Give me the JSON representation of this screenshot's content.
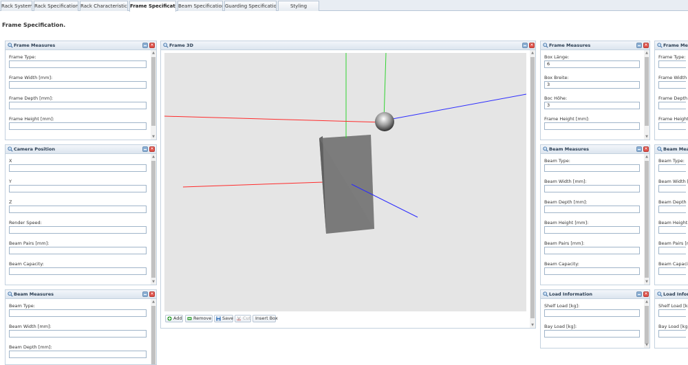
{
  "tabs": [
    {
      "label": "Rack System",
      "active": false
    },
    {
      "label": "Rack Specification",
      "active": false
    },
    {
      "label": "Rack Characteristics",
      "active": false
    },
    {
      "label": "Frame Specification",
      "active": true
    },
    {
      "label": "Beam Specification",
      "active": false
    },
    {
      "label": "Guarding Specification",
      "active": false
    },
    {
      "label": "Styling",
      "active": false
    }
  ],
  "page_title": "Frame Specification.",
  "left": {
    "frame_measures": {
      "title": "Frame Measures",
      "fields": [
        {
          "label": "Frame Type:",
          "value": ""
        },
        {
          "label": "Frame Width [mm]:",
          "value": ""
        },
        {
          "label": "Frame Depth [mm]:",
          "value": ""
        },
        {
          "label": "Frame Height [mm]:",
          "value": ""
        }
      ]
    },
    "camera_position": {
      "title": "Camera Position",
      "fields": [
        {
          "label": "X",
          "value": ""
        },
        {
          "label": "Y",
          "value": ""
        },
        {
          "label": "Z",
          "value": ""
        },
        {
          "label": "Render Speed:",
          "value": ""
        },
        {
          "label": "Beam Pairs [mm]:",
          "value": ""
        },
        {
          "label": "Beam Capacity:",
          "value": ""
        }
      ]
    },
    "beam_measures": {
      "title": "Beam Measures",
      "fields": [
        {
          "label": "Beam Type:",
          "value": ""
        },
        {
          "label": "Beam Width [mm]:",
          "value": ""
        },
        {
          "label": "Beam Depth [mm]:",
          "value": ""
        }
      ]
    }
  },
  "center": {
    "title": "Frame 3D",
    "toolbar": {
      "add": "Add",
      "remove": "Remove",
      "save": "Save",
      "cut": "Cut",
      "insert_box": "Insert Box"
    }
  },
  "right": {
    "frame_measures": {
      "title": "Frame Measures",
      "fields": [
        {
          "label": "Box Länge:",
          "value": "6"
        },
        {
          "label": "Box Breite:",
          "value": "3"
        },
        {
          "label": "Boc Höhe:",
          "value": "3"
        },
        {
          "label": "Frame Height [mm]:",
          "value": ""
        }
      ]
    },
    "beam_measures": {
      "title": "Beam Measures",
      "fields": [
        {
          "label": "Beam Type:",
          "value": ""
        },
        {
          "label": "Beam Width [mm]:",
          "value": ""
        },
        {
          "label": "Beam Depth [mm]:",
          "value": ""
        },
        {
          "label": "Beam Height [mm]:",
          "value": ""
        },
        {
          "label": "Beam Pairs [mm]:",
          "value": ""
        },
        {
          "label": "Beam Capacity:",
          "value": ""
        }
      ]
    },
    "load_information": {
      "title": "Load Information",
      "fields": [
        {
          "label": "Shelf Load [kg]:",
          "value": ""
        },
        {
          "label": "Bay Load [kg]:",
          "value": ""
        }
      ]
    }
  },
  "far_right": {
    "frame_measures": {
      "title": "Frame Meas",
      "fields": [
        {
          "label": "Frame Type:",
          "value": ""
        },
        {
          "label": "Frame Width [m",
          "value": ""
        },
        {
          "label": "Frame Depth [m",
          "value": ""
        },
        {
          "label": "Frame Height [m",
          "value": ""
        }
      ]
    },
    "beam_measures": {
      "title": "Beam Measu",
      "fields": [
        {
          "label": "Beam Type:",
          "value": ""
        },
        {
          "label": "Beam Width [m",
          "value": ""
        },
        {
          "label": "Beam Depth [m",
          "value": ""
        },
        {
          "label": "Beam Height [m",
          "value": ""
        },
        {
          "label": "Beam Pairs [m",
          "value": ""
        },
        {
          "label": "Beam Capacity",
          "value": ""
        }
      ]
    },
    "load_information": {
      "title": "Load Informa",
      "fields": [
        {
          "label": "Shelf Load [kg]",
          "value": ""
        },
        {
          "label": "Bay Load [kg]:",
          "value": ""
        }
      ]
    }
  },
  "colors": {
    "axis_x": "#ff2a2a",
    "axis_y": "#2fd32f",
    "axis_z": "#2a2aff",
    "viewport_bg": "#e5e5e5",
    "box_front": "#7a7a7a",
    "box_side": "#606060",
    "box_top": "#9a9a9a",
    "panel_title": "#2a3d52"
  },
  "icons": {
    "panel_header": "magnifier-icon",
    "collapse": "minimize-icon",
    "close": "close-icon",
    "add": "plus-circle-icon",
    "remove": "minus-icon",
    "save": "floppy-disk-icon",
    "cut": "scissors-icon"
  }
}
